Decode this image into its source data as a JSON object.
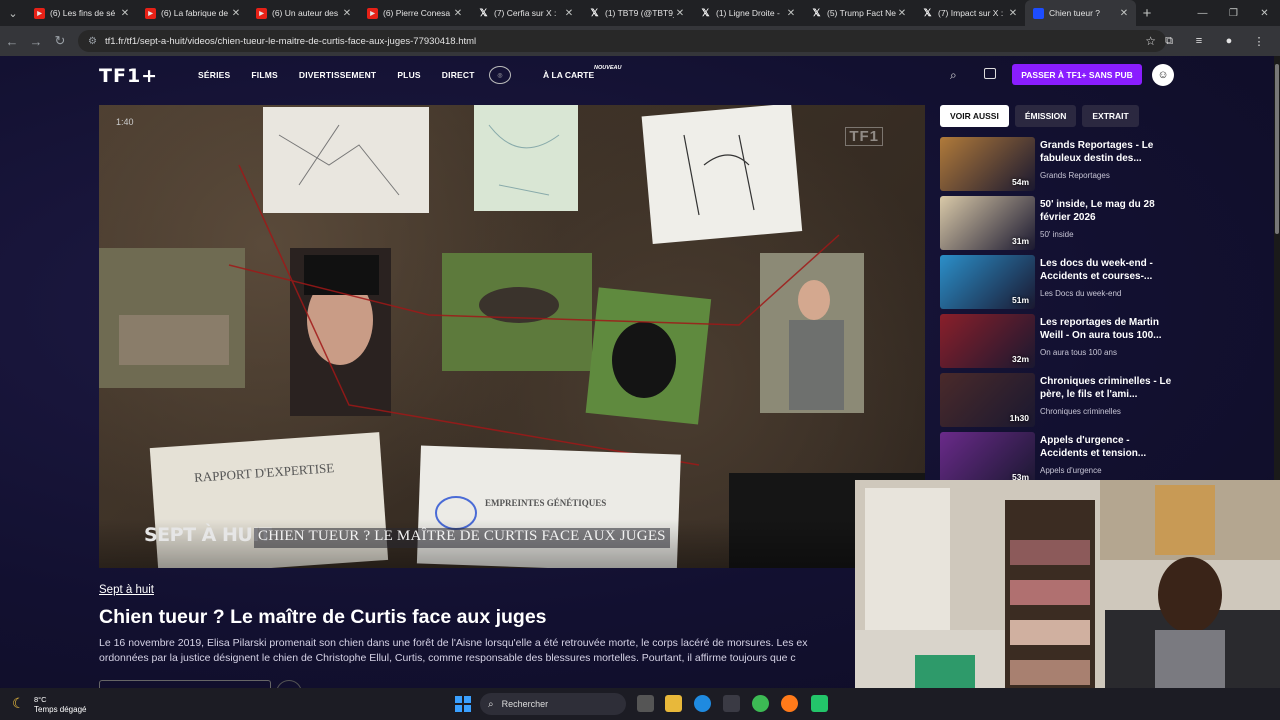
{
  "browser": {
    "tabs": [
      {
        "icon": "youtube-icon",
        "title": "(6) Les fins de sé"
      },
      {
        "icon": "youtube-icon",
        "title": "(6) La fabrique de"
      },
      {
        "icon": "youtube-icon",
        "title": "(6) Un auteur des"
      },
      {
        "icon": "youtube-icon",
        "title": "(6) Pierre Conesa"
      },
      {
        "icon": "x-icon",
        "title": "(7) Cerfia sur X : "
      },
      {
        "icon": "x-icon",
        "title": "(1) TBT9 (@TBT9_"
      },
      {
        "icon": "x-icon",
        "title": "(1) Ligne Droite -"
      },
      {
        "icon": "x-icon",
        "title": "(5) Trump Fact Ne"
      },
      {
        "icon": "x-icon",
        "title": "(7) Impact sur X :"
      },
      {
        "icon": "tf1-icon",
        "title": "Chien tueur ?",
        "active": true
      }
    ],
    "new_tab": "+",
    "url": "tf1.fr/tf1/sept-a-huit/videos/chien-tueur-le-maitre-de-curtis-face-aux-juges-77930418.html"
  },
  "header": {
    "logo": "TF1+",
    "nav": [
      "SÉRIES",
      "FILMS",
      "DIVERTISSEMENT",
      "PLUS",
      "DIRECT"
    ],
    "a_la_carte": "À LA CARTE",
    "nouveau": "NOUVEAU",
    "premium": "PASSER À TF1+ SANS PUB"
  },
  "video": {
    "timecode": "1:40",
    "channel_bug": "TF1",
    "brand": "SEPT À HUIT",
    "caption": "CHIEN TUEUR ? LE MAÎTRE DE CURTIS FACE AUX JUGES",
    "doc1": "RAPPORT D'EXPERTISE",
    "doc2": "EMPREINTES GÉNÉTIQUES"
  },
  "content": {
    "program": "Sept à huit",
    "title": "Chien tueur ? Le maître de Curtis face aux juges",
    "description": [
      "Le 16 novembre 2019, Elisa Pilarski promenait son chien dans une forêt de l'Aisne lorsqu'elle a été retrouvée morte, le corps lacéré de morsures. Les ex",
      "ordonnées par la justice désignent le chien de Christophe Ellul, Curtis, comme responsable des blessures mortelles. Pourtant, il affirme toujours que c"
    ]
  },
  "sidebar": {
    "tabs": [
      "VOIR AUSSI",
      "ÉMISSION",
      "EXTRAIT"
    ],
    "items": [
      {
        "title": "Grands Reportages - Le fabuleux destin des...",
        "subtitle": "Grands Reportages",
        "duration": "54m",
        "color": "#b07a3a"
      },
      {
        "title": "50' inside, Le mag du 28 février 2026",
        "subtitle": "50' inside",
        "duration": "31m",
        "color": "#d9c9a8"
      },
      {
        "title": "Les docs du week-end - Accidents et courses-...",
        "subtitle": "Les Docs du week-end",
        "duration": "51m",
        "color": "#2b8fc9"
      },
      {
        "title": "Les reportages de Martin Weill - On aura tous 100...",
        "subtitle": "On aura tous 100 ans",
        "duration": "32m",
        "color": "#8a1f2a"
      },
      {
        "title": "Chroniques criminelles - Le père, le fils et l'ami...",
        "subtitle": "Chroniques criminelles",
        "duration": "1h30",
        "color": "#4a2a2a"
      },
      {
        "title": "Appels d'urgence - Accidents et tension...",
        "subtitle": "Appels d'urgence",
        "duration": "53m",
        "color": "#6a2a8a"
      }
    ]
  },
  "taskbar": {
    "temp": "8°C",
    "weather": "Temps dégagé",
    "search": "Rechercher"
  }
}
